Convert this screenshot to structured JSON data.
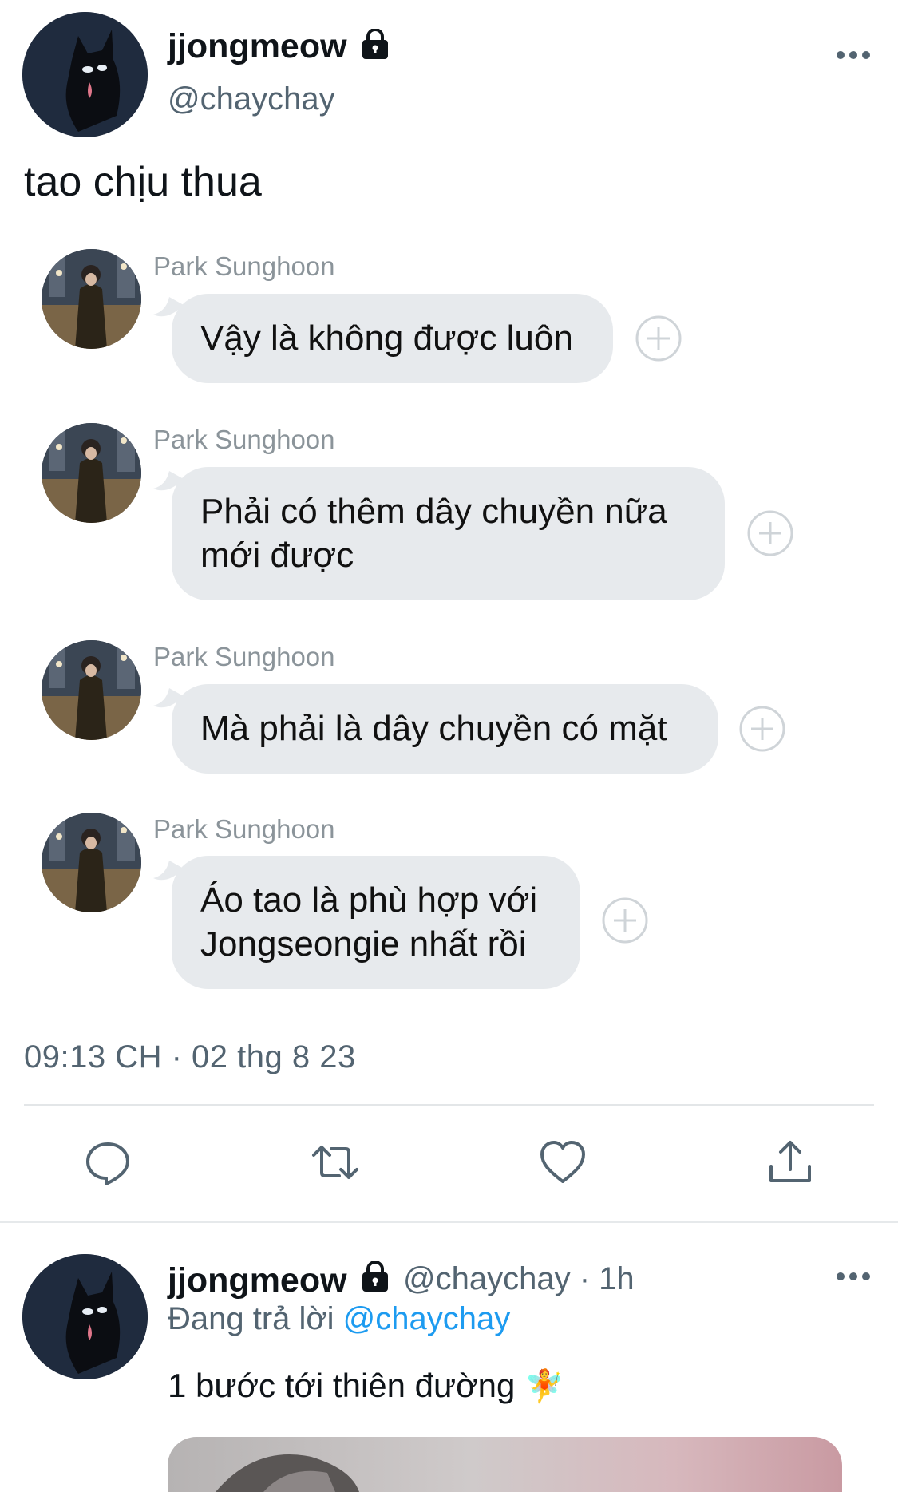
{
  "main_tweet": {
    "display_name": "jjongmeow",
    "handle": "@chaychay",
    "text": "tao chịu thua",
    "timestamp": "09:13 CH · 02 thg 8 23"
  },
  "messages": [
    {
      "sender": "Park Sunghoon",
      "text": "Vậy là không được luôn"
    },
    {
      "sender": "Park Sunghoon",
      "text_line1": "Phải có thêm dây chuyền nữa",
      "text_line2": "mới được"
    },
    {
      "sender": "Park Sunghoon",
      "text": "Mà phải là dây chuyền có mặt"
    },
    {
      "sender": "Park Sunghoon",
      "text_line1": "Áo tao là phù hợp với",
      "text_line2": "Jongseongie nhất rồi"
    }
  ],
  "reply_tweet": {
    "display_name": "jjongmeow",
    "handle": "@chaychay",
    "dot": "·",
    "time": "1h",
    "replying_to_label": "Đang trả lời",
    "replying_to_handle": "@chaychay",
    "text": "1 bước tới thiên đường",
    "emoji": "🧚"
  },
  "icons": {
    "lock": "lock-icon",
    "more": "more-options-icon",
    "add": "add-reaction-icon",
    "reply": "reply-icon",
    "retweet": "retweet-icon",
    "like": "like-icon",
    "share": "share-icon"
  },
  "colors": {
    "link": "#1d9bf0",
    "secondary_text": "#536471",
    "bubble": "#e7eaed"
  }
}
